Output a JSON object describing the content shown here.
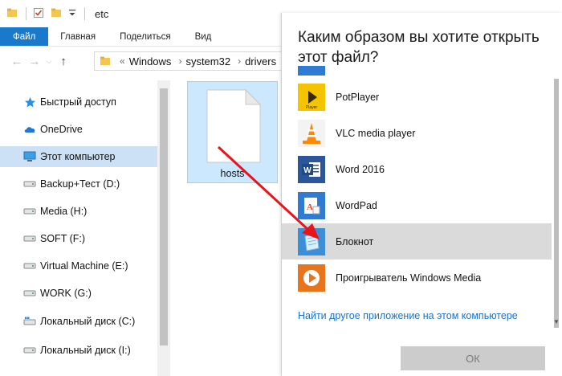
{
  "window": {
    "title": "etc"
  },
  "ribbon": {
    "tabs": [
      "Файл",
      "Главная",
      "Поделиться",
      "Вид"
    ]
  },
  "address": {
    "crumbs": [
      "Windows",
      "system32",
      "drivers"
    ]
  },
  "sidebar": {
    "items": [
      {
        "label": "Быстрый доступ",
        "icon": "star-icon"
      },
      {
        "label": "OneDrive",
        "icon": "cloud-icon"
      },
      {
        "label": "Этот компьютер",
        "icon": "computer-icon"
      },
      {
        "label": "Backup+Тест (D:)",
        "icon": "drive-icon"
      },
      {
        "label": "Media (H:)",
        "icon": "drive-icon"
      },
      {
        "label": "SOFT (F:)",
        "icon": "drive-icon"
      },
      {
        "label": "Virtual Machine (E:)",
        "icon": "drive-icon"
      },
      {
        "label": "WORK (G:)",
        "icon": "drive-icon"
      },
      {
        "label": "Локальный диск (C:)",
        "icon": "drive-icon"
      },
      {
        "label": "Локальный диск (I:)",
        "icon": "drive-icon"
      }
    ]
  },
  "file": {
    "name": "hosts"
  },
  "dialog": {
    "title": "Каким образом вы хотите открыть этот файл?",
    "apps": [
      {
        "name": "PotPlayer",
        "icon": "potplayer-icon",
        "color": "#f5c400"
      },
      {
        "name": "VLC media player",
        "icon": "vlc-icon",
        "color": "#ff8800"
      },
      {
        "name": "Word 2016",
        "icon": "word-icon",
        "color": "#2b579a"
      },
      {
        "name": "WordPad",
        "icon": "wordpad-icon",
        "color": "#2f7bd4"
      },
      {
        "name": "Блокнот",
        "icon": "notepad-icon",
        "color": "#3c8fd6"
      },
      {
        "name": "Проигрыватель Windows Media",
        "icon": "windows-media-player-icon",
        "color": "#e8741c"
      }
    ],
    "find_link": "Найти другое приложение на этом компьютере",
    "ok_label": "ОК"
  },
  "colors": {
    "accent": "#1979ca",
    "selection": "#cce8ff",
    "link": "#1a73c8",
    "arrow": "#e8141c"
  }
}
